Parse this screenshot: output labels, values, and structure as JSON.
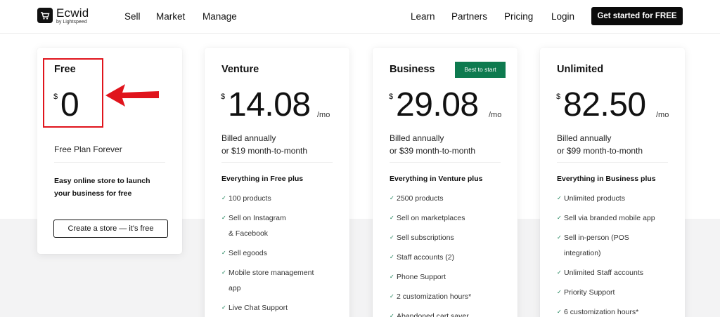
{
  "header": {
    "logo_text": "Ecwid",
    "logo_sub": "by Lightspeed",
    "nav_left": [
      "Sell",
      "Market",
      "Manage"
    ],
    "nav_right": [
      "Learn",
      "Partners",
      "Pricing",
      "Login"
    ],
    "cta_label": "Get started for FREE"
  },
  "colors": {
    "accent_green": "#0e7a4f",
    "annotation_red": "#e0141c",
    "cta_bg": "#0b0b0b"
  },
  "plans": {
    "free": {
      "name": "Free",
      "currency": "$",
      "price": "0",
      "subtitle": "Free Plan Forever",
      "desc_lines": [
        "Easy online store to launch",
        "your business for free"
      ],
      "button_label": "Create a store — it's free"
    },
    "venture": {
      "name": "Venture",
      "currency": "$",
      "price": "14.08",
      "per": "/mo",
      "billing": [
        "Billed annually",
        "or $19 month-to-month"
      ],
      "features_head": "Everything in Free plus",
      "features": [
        [
          "100 products"
        ],
        [
          "Sell on Instagram",
          "& Facebook"
        ],
        [
          "Sell egoods"
        ],
        [
          "Mobile store management",
          "app"
        ],
        [
          "Live Chat Support"
        ]
      ]
    },
    "business": {
      "name": "Business",
      "badge": "Best to start",
      "currency": "$",
      "price": "29.08",
      "per": "/mo",
      "billing": [
        "Billed annually",
        "or $39 month-to-month"
      ],
      "features_head": "Everything in Venture plus",
      "features": [
        [
          "2500 products"
        ],
        [
          "Sell on marketplaces"
        ],
        [
          "Sell subscriptions"
        ],
        [
          "Staff accounts (2)"
        ],
        [
          "Phone Support"
        ],
        [
          "2 customization hours*"
        ],
        [
          "Abandoned cart saver"
        ]
      ]
    },
    "unlimited": {
      "name": "Unlimited",
      "currency": "$",
      "price": "82.50",
      "per": "/mo",
      "billing": [
        "Billed annually",
        "or $99 month-to-month"
      ],
      "features_head": "Everything in Business plus",
      "features": [
        [
          "Unlimited products"
        ],
        [
          "Sell via branded mobile app"
        ],
        [
          "Sell in-person (POS",
          "integration)"
        ],
        [
          "Unlimited Staff accounts"
        ],
        [
          "Priority Support"
        ],
        [
          "6 customization hours*"
        ]
      ]
    }
  },
  "icons": {
    "check": "check-icon",
    "cart": "cart-logo-icon",
    "arrow": "arrow-left-icon"
  }
}
